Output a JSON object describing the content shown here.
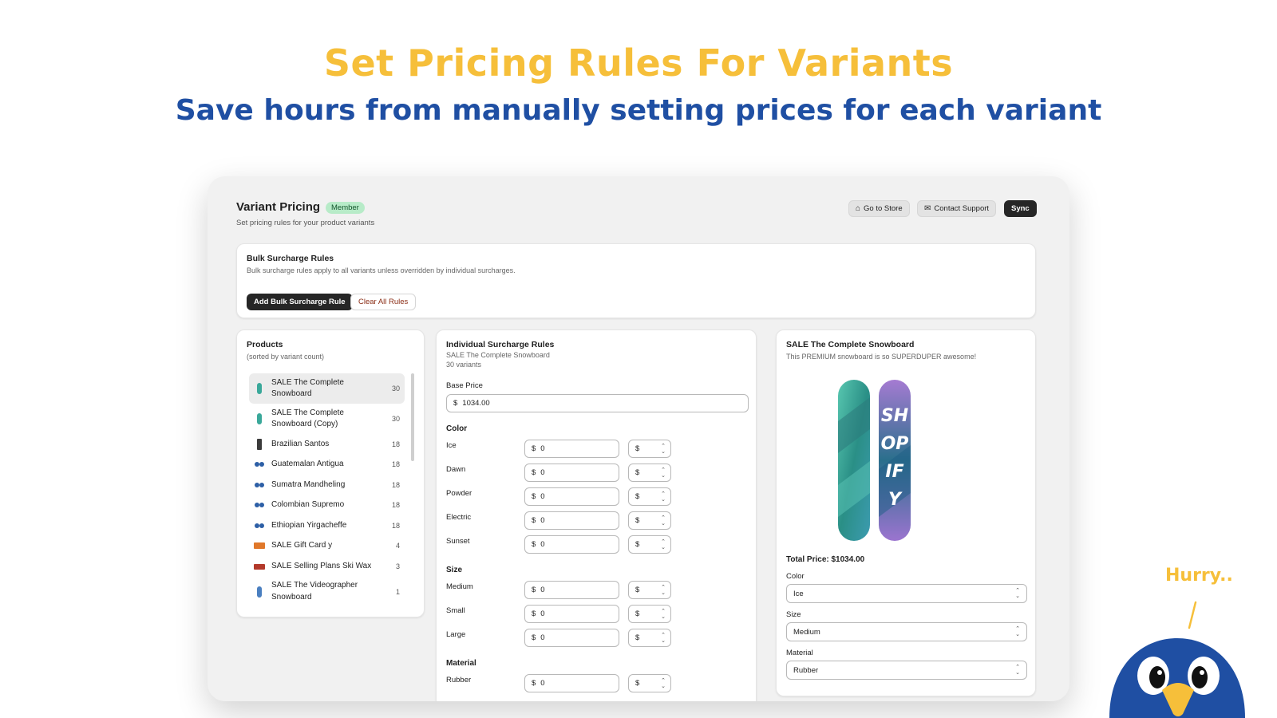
{
  "hero": {
    "title": "Set Pricing Rules For Variants",
    "subtitle": "Save hours from manually setting prices for each variant"
  },
  "app": {
    "title": "Variant Pricing",
    "badge": "Member",
    "subtitle": "Set pricing rules for your product variants",
    "buttons": {
      "store": "Go to Store",
      "support": "Contact Support",
      "sync": "Sync"
    }
  },
  "bulk": {
    "title": "Bulk Surcharge Rules",
    "description": "Bulk surcharge rules apply to all variants unless overridden by individual surcharges.",
    "add_label": "Add Bulk Surcharge Rule",
    "clear_label": "Clear All Rules"
  },
  "products": {
    "title": "Products",
    "subtitle": "(sorted by variant count)",
    "items": [
      {
        "name": "SALE The Complete Snowboard",
        "count": "30",
        "icon": "snowboard-icon"
      },
      {
        "name": "SALE The Complete Snowboard (Copy)",
        "count": "30",
        "icon": "snowboard-icon"
      },
      {
        "name": "Brazilian Santos",
        "count": "18",
        "icon": "coffee-bag-icon"
      },
      {
        "name": "Guatemalan Antigua",
        "count": "18",
        "icon": "coffee-beans-icon"
      },
      {
        "name": "Sumatra Mandheling",
        "count": "18",
        "icon": "coffee-beans-icon"
      },
      {
        "name": "Colombian Supremo",
        "count": "18",
        "icon": "coffee-beans-icon"
      },
      {
        "name": "Ethiopian Yirgacheffe",
        "count": "18",
        "icon": "coffee-beans-icon"
      },
      {
        "name": "SALE Gift Card y",
        "count": "4",
        "icon": "gift-card-icon"
      },
      {
        "name": "SALE Selling Plans Ski Wax",
        "count": "3",
        "icon": "ski-wax-icon"
      },
      {
        "name": "SALE The Videographer Snowboard",
        "count": "1",
        "icon": "snowboard-icon"
      }
    ]
  },
  "individual": {
    "title": "Individual Surcharge Rules",
    "product": "SALE The Complete Snowboard",
    "variants": "30 variants",
    "base_price_label": "Base Price",
    "currency": "$",
    "base_price": "1034.00",
    "groups": [
      {
        "name": "Color",
        "options": [
          {
            "label": "Ice",
            "value": "0",
            "type": "$"
          },
          {
            "label": "Dawn",
            "value": "0",
            "type": "$"
          },
          {
            "label": "Powder",
            "value": "0",
            "type": "$"
          },
          {
            "label": "Electric",
            "value": "0",
            "type": "$"
          },
          {
            "label": "Sunset",
            "value": "0",
            "type": "$"
          }
        ]
      },
      {
        "name": "Size",
        "options": [
          {
            "label": "Medium",
            "value": "0",
            "type": "$"
          },
          {
            "label": "Small",
            "value": "0",
            "type": "$"
          },
          {
            "label": "Large",
            "value": "0",
            "type": "$"
          }
        ]
      },
      {
        "name": "Material",
        "options": [
          {
            "label": "Rubber",
            "value": "0",
            "type": "$"
          }
        ]
      }
    ]
  },
  "preview": {
    "title": "SALE The Complete Snowboard",
    "description": "This PREMIUM snowboard is so SUPERDUPER awesome!",
    "total": "Total Price: $1034.00",
    "selectors": [
      {
        "label": "Color",
        "value": "Ice"
      },
      {
        "label": "Size",
        "value": "Medium"
      },
      {
        "label": "Material",
        "value": "Rubber"
      }
    ]
  },
  "mascot": {
    "speech": "Hurry.."
  },
  "colors": {
    "accent_yellow": "#f6bf3a",
    "brand_blue": "#1f4fa3",
    "dark_button": "#262626"
  }
}
